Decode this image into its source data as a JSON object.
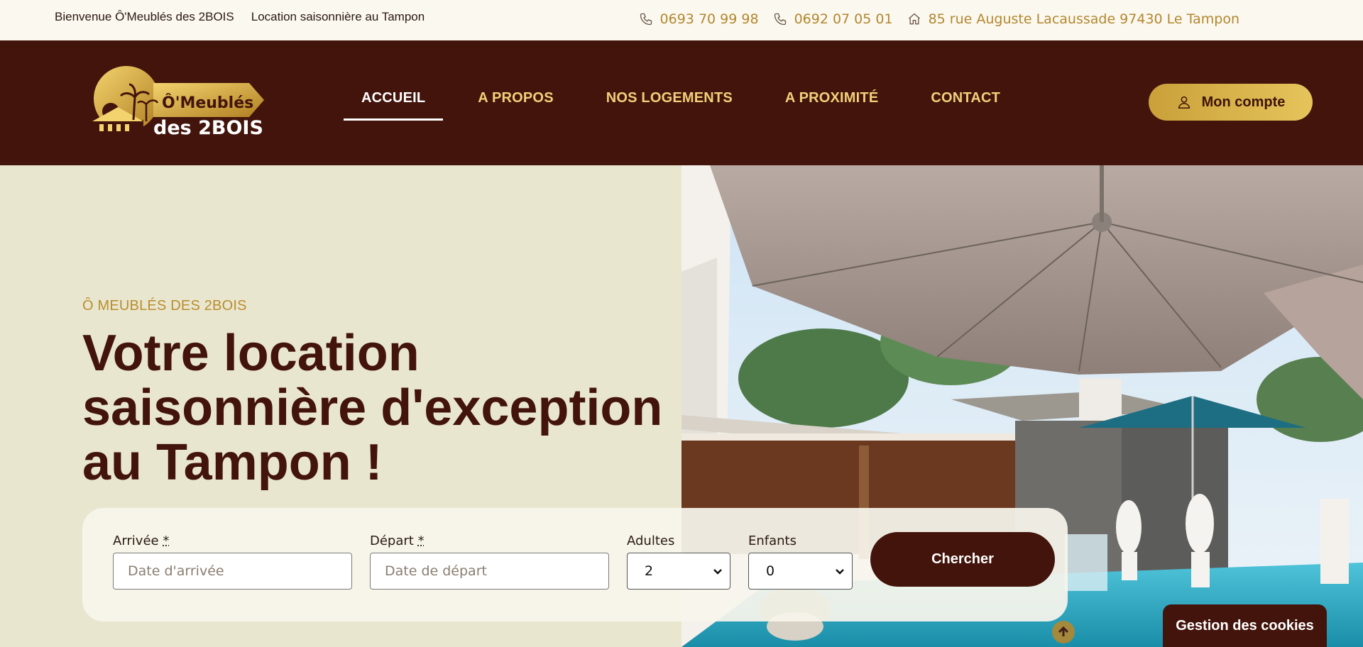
{
  "topbar": {
    "welcome": "Bienvenue Ô'Meublés des 2BOIS",
    "tagline": "Location saisonnière au Tampon",
    "phone1": "0693 70 99 98",
    "phone2": "0692 07 05 01",
    "address": "85 rue Auguste Lacaussade 97430 Le Tampon"
  },
  "logo": {
    "line1": "Ô'Meublés",
    "line2": "des 2BOIS"
  },
  "nav": {
    "items": [
      {
        "label": "ACCUEIL"
      },
      {
        "label": "A PROPOS"
      },
      {
        "label": "NOS LOGEMENTS"
      },
      {
        "label": "A PROXIMITÉ"
      },
      {
        "label": "CONTACT"
      }
    ],
    "active": "ACCUEIL",
    "account_label": "Mon compte"
  },
  "hero": {
    "eyebrow": "Ô MEUBLÉS DES 2BOIS",
    "headline": "Votre location saisonnière d'exception au Tampon !"
  },
  "booking": {
    "arrival_label": "Arrivée",
    "arrival_placeholder": "Date d'arrivée",
    "departure_label": "Départ",
    "departure_placeholder": "Date de départ",
    "required_mark": "*",
    "adults_label": "Adultes",
    "adults_value": "2",
    "children_label": "Enfants",
    "children_value": "0",
    "search_label": "Chercher"
  },
  "cookies_label": "Gestion des cookies",
  "icons": [
    "phone-icon",
    "home-icon",
    "user-icon",
    "chevron-down-icon",
    "arrow-up-icon"
  ],
  "colors": {
    "brand_dark": "#43140b",
    "brand_gold": "#c9a03a",
    "nav_text": "#f0d07a",
    "hero_bg": "#e9e6d0"
  }
}
